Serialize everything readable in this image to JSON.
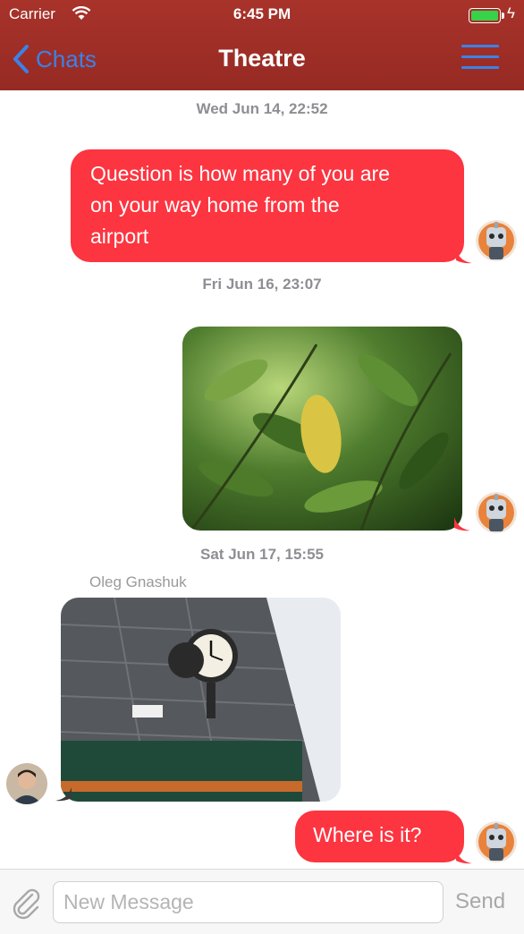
{
  "status_bar": {
    "carrier": "Carrier",
    "time": "6:45 PM"
  },
  "nav": {
    "back_label": "Chats",
    "title": "Theatre"
  },
  "messages": [
    {
      "timestamp": "Wed Jun 14, 22:52",
      "type": "text",
      "direction": "outgoing",
      "text_lines": [
        "Question is how many of you are",
        "on your way home from the",
        "airport"
      ]
    },
    {
      "timestamp": "Fri Jun 16, 23:07",
      "type": "image",
      "direction": "outgoing",
      "image": "green-leaves-photo"
    },
    {
      "timestamp": "Sat Jun 17, 15:55",
      "sender": "Oleg Gnashuk",
      "type": "image",
      "direction": "incoming",
      "image": "street-clock-photo"
    },
    {
      "type": "text",
      "direction": "outgoing",
      "text": "Where is it?"
    }
  ],
  "composer": {
    "placeholder": "New Message",
    "send_label": "Send"
  },
  "colors": {
    "navbar": "#a8332b",
    "bubble_outgoing": "#fc3540",
    "accent": "#3b82e8",
    "timestamp": "#8e8e93"
  }
}
